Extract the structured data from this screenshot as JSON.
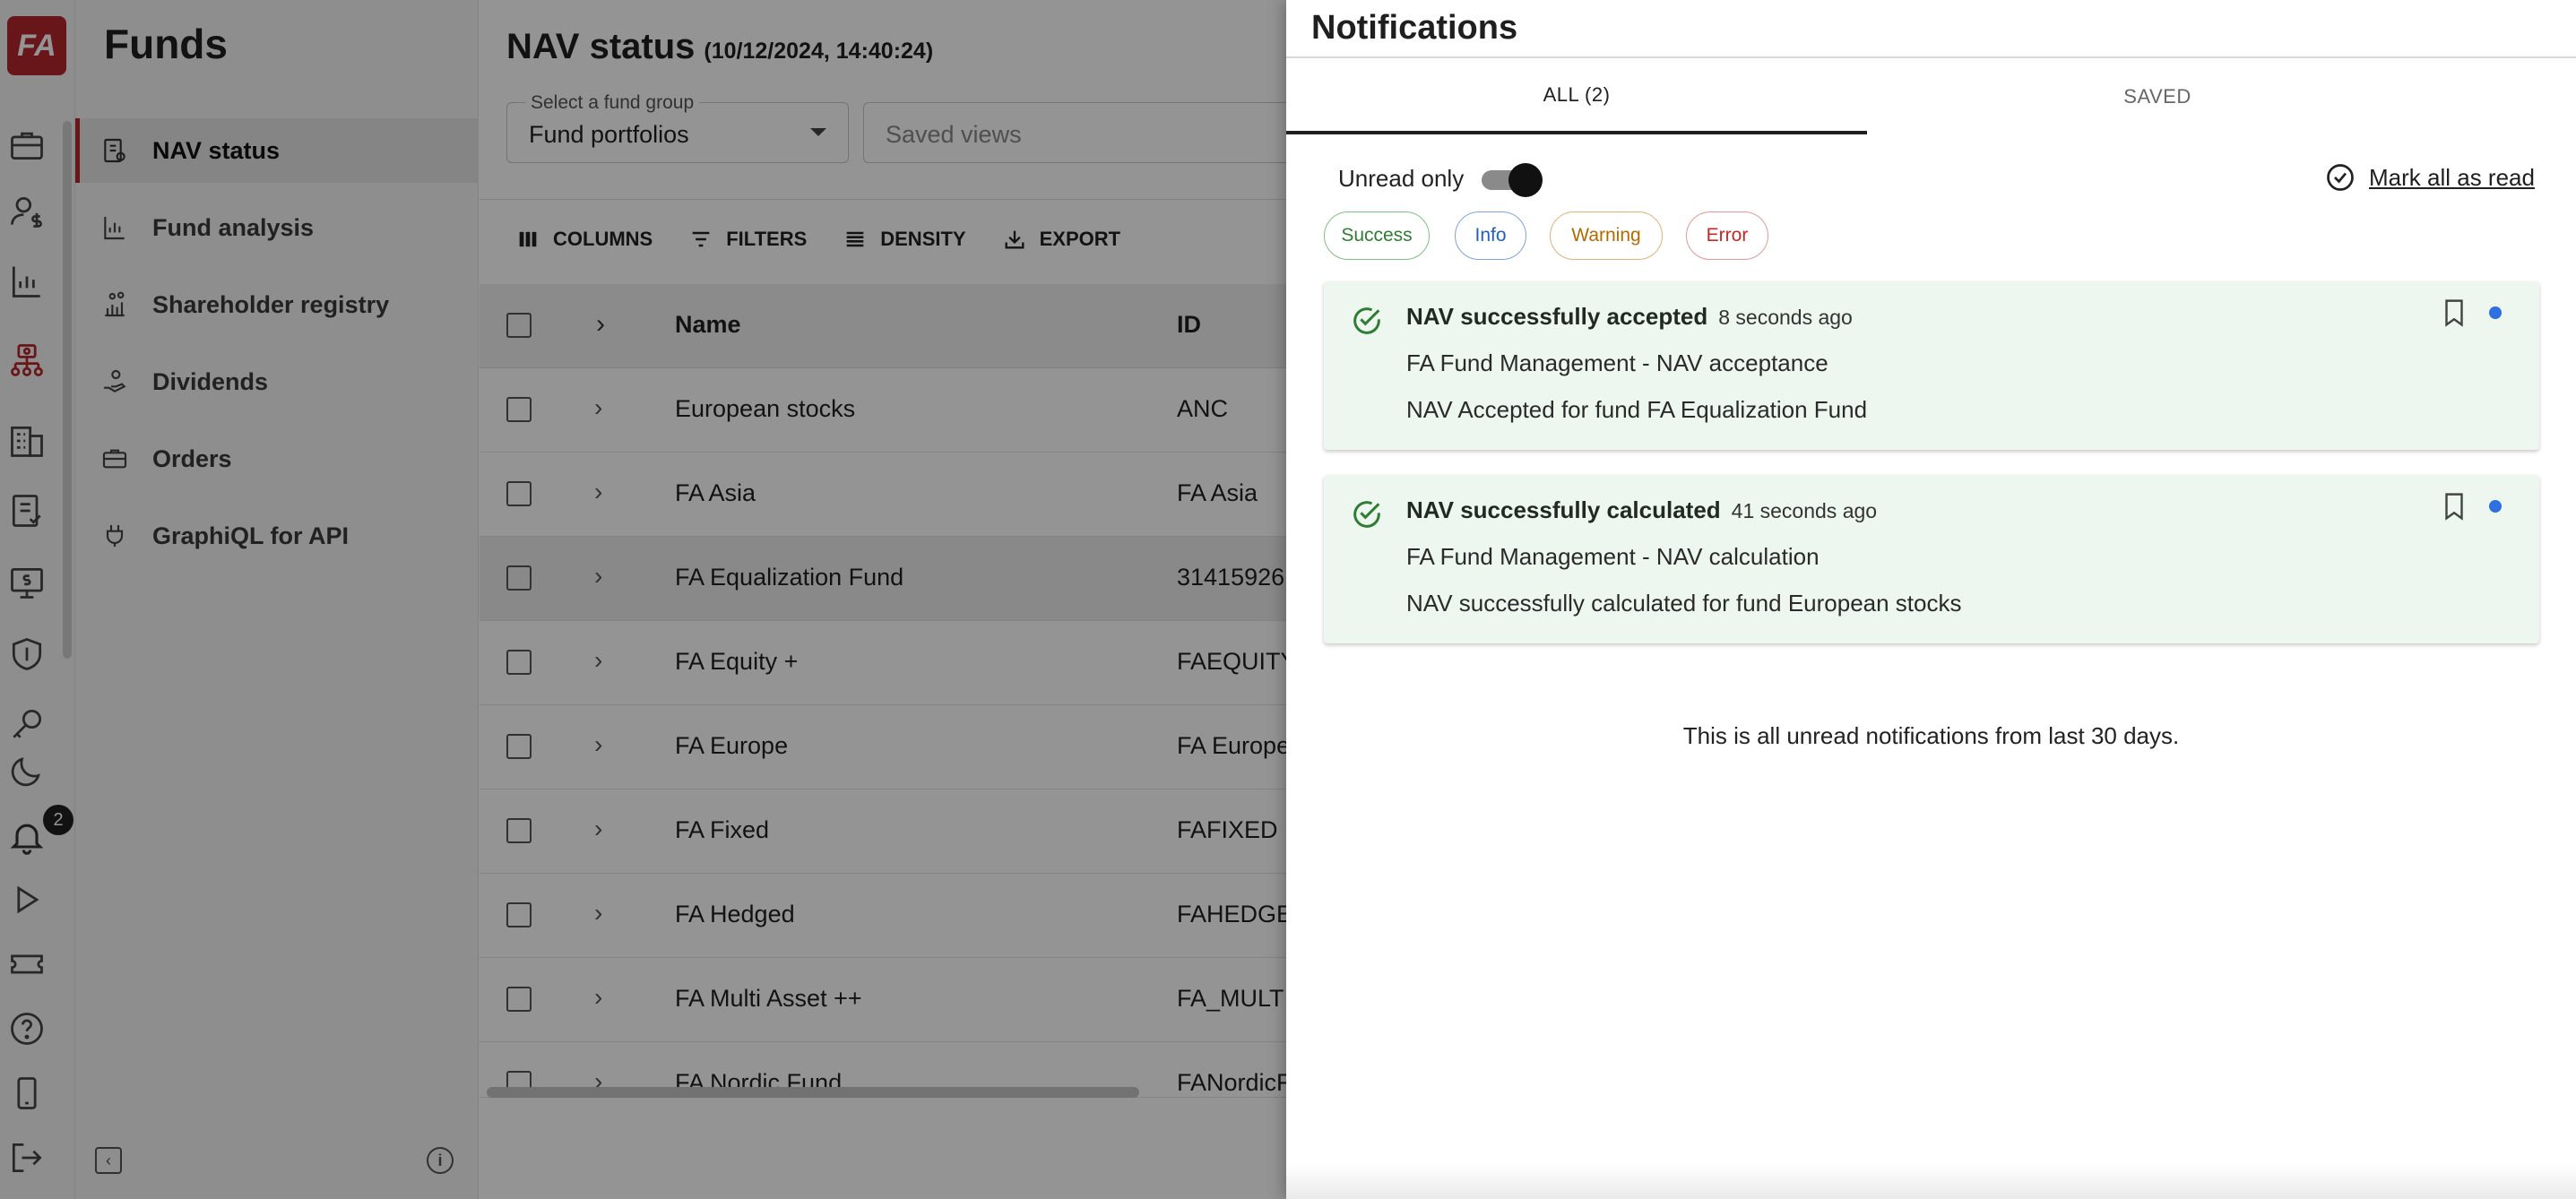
{
  "app": {
    "logo_text": "FA",
    "section_title": "Funds",
    "notification_count": "2",
    "brand_color": "#b3262c"
  },
  "rail_icons": [
    "briefcase-icon",
    "user-dollar-icon",
    "report-chart-icon",
    "fund-structure-icon",
    "building-icon",
    "document-check-icon",
    "monitor-dollar-icon",
    "shield-icon",
    "key-icon",
    "moon-icon",
    "bell-icon",
    "play-icon",
    "ticket-icon",
    "help-icon",
    "device-icon",
    "logout-icon"
  ],
  "sidebar": {
    "items": [
      {
        "label": "NAV status",
        "icon": "report-icon",
        "active": true
      },
      {
        "label": "Fund analysis",
        "icon": "bar-chart-icon",
        "active": false
      },
      {
        "label": "Shareholder registry",
        "icon": "registry-chart-icon",
        "active": false
      },
      {
        "label": "Dividends",
        "icon": "hand-coin-icon",
        "active": false
      },
      {
        "label": "Orders",
        "icon": "briefcase-icon",
        "active": false
      },
      {
        "label": "GraphiQL for API",
        "icon": "plug-icon",
        "active": false
      }
    ]
  },
  "main": {
    "title": "NAV status",
    "timestamp": "(10/12/2024, 14:40:24)",
    "fund_group": {
      "label": "Select a fund group",
      "value": "Fund portfolios"
    },
    "saved_views": {
      "placeholder": "Saved views"
    },
    "toolbar": {
      "columns": "COLUMNS",
      "filters": "FILTERS",
      "density": "DENSITY",
      "export": "EXPORT"
    },
    "table": {
      "headers": {
        "name": "Name",
        "id": "ID"
      },
      "rows": [
        {
          "name": "European stocks",
          "id": "ANC"
        },
        {
          "name": "FA Asia",
          "id": "FA Asia"
        },
        {
          "name": "FA Equalization Fund",
          "id": "31415926"
        },
        {
          "name": "FA Equity +",
          "id": "FAEQUITY"
        },
        {
          "name": "FA Europe",
          "id": "FA Europe"
        },
        {
          "name": "FA Fixed",
          "id": "FAFIXED"
        },
        {
          "name": "FA Hedged",
          "id": "FAHEDGEI"
        },
        {
          "name": "FA Multi Asset ++",
          "id": "FA_MULTI"
        },
        {
          "name": "FA Nordic Fund",
          "id": "FANordicF"
        }
      ]
    }
  },
  "notifications": {
    "title": "Notifications",
    "tabs": {
      "all": "ALL (2)",
      "saved": "SAVED"
    },
    "unread_only_label": "Unread only",
    "unread_only": true,
    "mark_all_label": "Mark all as read",
    "chips": {
      "success": "Success",
      "info": "Info",
      "warning": "Warning",
      "error": "Error"
    },
    "items": [
      {
        "title": "NAV successfully accepted",
        "time": "8 seconds ago",
        "line1": "FA Fund Management - NAV acceptance",
        "line2": "NAV Accepted for fund FA Equalization Fund",
        "unread": true
      },
      {
        "title": "NAV successfully calculated",
        "time": "41 seconds ago",
        "line1": "FA Fund Management - NAV calculation",
        "line2": "NAV successfully calculated for fund European stocks",
        "unread": true
      }
    ],
    "footer": "This is all unread notifications from last 30 days."
  }
}
